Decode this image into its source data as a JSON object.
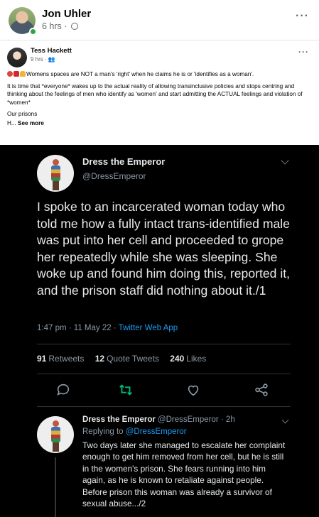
{
  "post": {
    "author": "Jon Uhler",
    "time": "6 hrs ·",
    "more": "···"
  },
  "shared": {
    "author": "Tess Hackett",
    "time": "9 hrs · ",
    "more": "···",
    "line1": "Womens spaces are NOT a man's 'right' when he claims he is or 'identifies as a woman'.",
    "line2": "It is time that *everyone* wakes up to the actual reality of allowing transinclusive policies  and stops centring and thinking about the feelings of men who identify as 'women' and start admitting the ACTUAL feelings and violation of *women*",
    "line3": "Our prisons",
    "line4_prefix": "H... ",
    "see_more": "See more"
  },
  "tweet": {
    "name": "Dress the Emperor",
    "handle": "@DressEmperor",
    "text": "I spoke to an incarcerated woman today who told me how a fully intact trans-identified male was put into her cell and proceeded to grope her repeatedly while she was sleeping. She woke up and found him doing this, reported it, and the prison staff did nothing about it./1",
    "timestamp": "1:47 pm · 11 May 22 · ",
    "app": "Twitter Web App",
    "retweets_count": "91",
    "retweets_label": "Retweets",
    "quotes_count": "12",
    "quotes_label": "Quote Tweets",
    "likes_count": "240",
    "likes_label": "Likes"
  },
  "reply": {
    "name": "Dress the Emperor",
    "handle_time": "@DressEmperor · 2h",
    "replying_prefix": "Replying to ",
    "replying_to": "@DressEmperor",
    "text": "Two days later she managed to escalate her complaint enough to get him removed from her cell, but he is still in the women's prison. She fears running into him again, as he is known to retaliate against people. Before prison this woman was already a survivor of sexual abuse.../2"
  },
  "colors": {
    "twitter_blue": "#1d9bf0",
    "retweet_green": "#00ba7c",
    "tweet_bg": "#000000",
    "online_green": "#31a24c"
  }
}
